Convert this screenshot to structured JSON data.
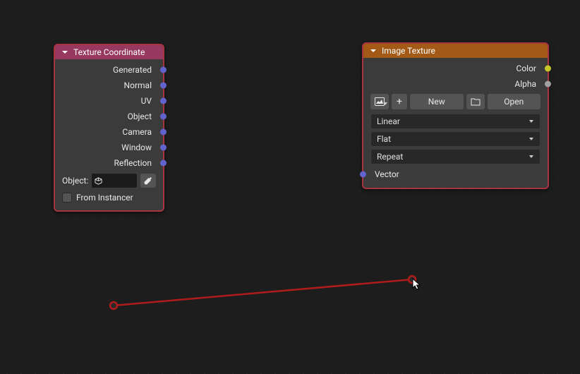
{
  "nodes": {
    "texCoord": {
      "title": "Texture Coordinate",
      "outputs": [
        "Generated",
        "Normal",
        "UV",
        "Object",
        "Camera",
        "Window",
        "Reflection"
      ],
      "objectLabel": "Object:",
      "fromInstancerLabel": "From Instancer"
    },
    "imageTex": {
      "title": "Image Texture",
      "outputs": [
        "Color",
        "Alpha"
      ],
      "toolbar": {
        "new": "New",
        "open": "Open"
      },
      "interp": "Linear",
      "projection": "Flat",
      "extension": "Repeat",
      "inputs": [
        "Vector"
      ]
    }
  }
}
